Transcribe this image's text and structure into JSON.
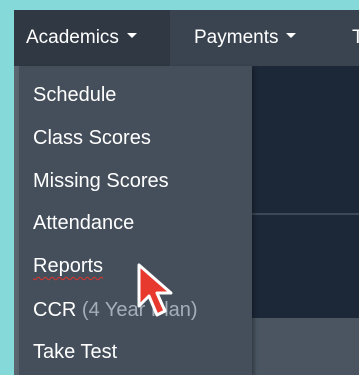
{
  "navbar": {
    "items": [
      {
        "label": "Academics"
      },
      {
        "label": "Payments"
      },
      {
        "label": "T"
      }
    ]
  },
  "dropdown": {
    "items": [
      {
        "label": "Schedule"
      },
      {
        "label": "Class Scores"
      },
      {
        "label": "Missing Scores"
      },
      {
        "label": "Attendance"
      },
      {
        "label": "Reports"
      },
      {
        "label": "CCR",
        "suffix": "(4 Year Plan)"
      },
      {
        "label": "Take Test"
      }
    ]
  },
  "icons": {
    "caret": "caret-down-icon",
    "cursor": "mouse-pointer-icon"
  },
  "colors": {
    "navbar": "#3a4450",
    "dropdown": "#454f5b",
    "page_background": "#85d9d9",
    "cursor": "#e8392f"
  }
}
